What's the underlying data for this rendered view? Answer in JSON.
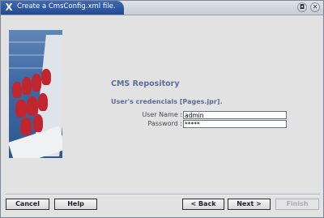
{
  "window": {
    "title": "Create a CmsConfig.xml file.",
    "app_icon": "X",
    "shade_glyph": "◘",
    "close_glyph": "✕"
  },
  "main": {
    "heading": "CMS Repository",
    "credentials_note": "User's credencials [Pages.jpr].",
    "username_label": "User Name :",
    "username_value": "admin",
    "password_label": "Password :",
    "password_value": "*****"
  },
  "buttons": {
    "cancel": "Cancel",
    "help": "Help",
    "back": "< Back",
    "next": "Next >",
    "finish": "Finish",
    "finish_enabled": false
  },
  "colors": {
    "title_bar": "#2f5aa3",
    "heading_text": "#5d6d9a",
    "window_bg": "#e2e2e2"
  }
}
